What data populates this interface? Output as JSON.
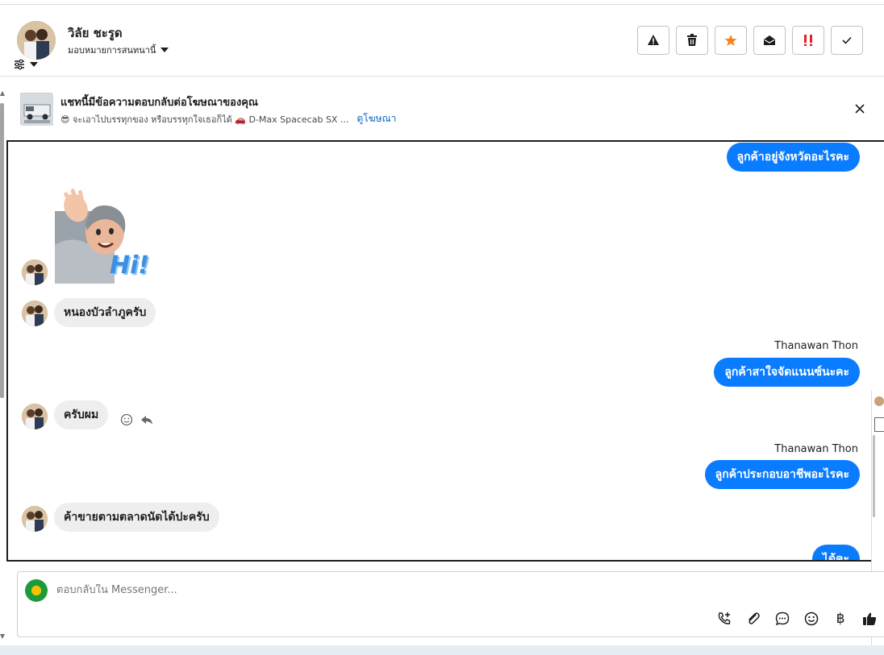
{
  "header": {
    "contact_name": "วิลัย ชะรูด",
    "assign_label": "มอบหมายการสนทนานี้",
    "actions": [
      "warning-icon",
      "trash-icon",
      "star-icon",
      "mark-unread-icon",
      "important-icon",
      "check-icon"
    ],
    "accent_colors": {
      "star": "#f5821f",
      "important": "#e4202e"
    }
  },
  "banner": {
    "title": "แชทนี้มีข้อความตอบกลับต่อโฆษณาของคุณ",
    "subtitle": "😎 จะเอาไปบรรทุกของ หรือบรรทุกใจเธอก็ได้ 🚗 D-Max Spacecab SX ...",
    "link": "ดูโฆษณา"
  },
  "chat": {
    "messages": [
      {
        "dir": "out",
        "text": "ลูกค้าอยู่จังหวัดอะไรคะ"
      },
      {
        "dir": "in",
        "type": "sticker",
        "text": "Hi!"
      },
      {
        "dir": "in",
        "text": "หนองบัวลำภูครับ"
      },
      {
        "dir": "out",
        "sender": "Thanawan Thon",
        "text": "ลูกค้าสาใจจัดแนนซ์นะคะ"
      },
      {
        "dir": "in",
        "text": "ครับผม"
      },
      {
        "dir": "out",
        "sender": "Thanawan Thon",
        "text": "ลูกค้าประกอบอาชีพอะไรคะ"
      },
      {
        "dir": "in",
        "text": "ค้าขายตามตลาดนัดได้ปะครับ"
      },
      {
        "dir": "out",
        "text": "ได้คะ"
      }
    ],
    "colors": {
      "outgoing": "#0a7cff",
      "incoming": "#eeeeef"
    }
  },
  "composer": {
    "placeholder": "ตอบกลับใน Messenger...",
    "tools": [
      "call-add-icon",
      "attachment-icon",
      "saved-reply-icon",
      "emoji-icon",
      "baht-icon",
      "like-icon"
    ]
  }
}
